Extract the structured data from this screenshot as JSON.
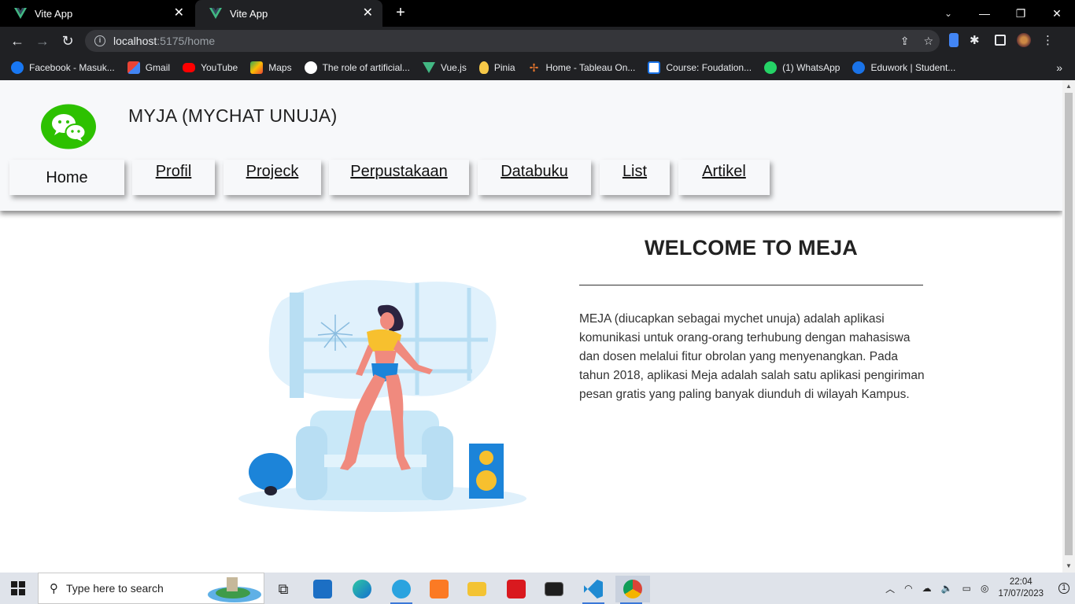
{
  "browser": {
    "tabs": [
      {
        "title": "Vite App",
        "close": "✕"
      },
      {
        "title": "Vite App",
        "close": "✕"
      }
    ],
    "new_tab": "+",
    "window_controls": {
      "minimize": "—",
      "restore": "❐",
      "close": "✕"
    },
    "address": {
      "host": "localhost",
      "path": ":5175/home"
    },
    "bookmarks": [
      {
        "label": "Facebook - Masuk...",
        "color": "#1877f2"
      },
      {
        "label": "Gmail",
        "color": "#ea4335"
      },
      {
        "label": "YouTube",
        "color": "#ff0000"
      },
      {
        "label": "Maps",
        "color": "#34a853"
      },
      {
        "label": "The role of artificial...",
        "color": "#ffffff"
      },
      {
        "label": "Vue.js",
        "color": "#42b883"
      },
      {
        "label": "Pinia",
        "color": "#f7c948"
      },
      {
        "label": "Home - Tableau On...",
        "color": "#e8762d"
      },
      {
        "label": "Course: Foudation...",
        "color": "#ffffff"
      },
      {
        "label": "(1) WhatsApp",
        "color": "#25d366"
      },
      {
        "label": "Eduwork | Student...",
        "color": "#1a73e8"
      }
    ],
    "bookmarks_more": "»"
  },
  "app": {
    "brand_title": "MYJA (MYCHAT UNUJA)",
    "logo_icon": "wechat-icon",
    "accent": "#2dc100",
    "nav": [
      {
        "label": "Home",
        "active": true
      },
      {
        "label": "Profil",
        "active": false
      },
      {
        "label": "Projeck",
        "active": false
      },
      {
        "label": "Perpustakaan",
        "active": false
      },
      {
        "label": "Databuku",
        "active": false
      },
      {
        "label": "List",
        "active": false
      },
      {
        "label": "Artikel",
        "active": false
      }
    ],
    "welcome_title": "WELCOME TO MEJA",
    "description": "MEJA (diucapkan sebagai mychet unuja) adalah aplikasi komunikasi untuk orang-orang terhubung dengan mahasiswa dan dosen melalui fitur obrolan yang menyenangkan. Pada tahun 2018, aplikasi Meja adalah salah satu aplikasi pengiriman pesan gratis yang paling banyak diunduh di wilayah Kampus."
  },
  "taskbar": {
    "search_placeholder": "Type here to search",
    "apps": [
      "task-view",
      "mail",
      "edge",
      "telegram",
      "xampp",
      "file-explorer",
      "acrobat",
      "terminal",
      "vscode",
      "chrome"
    ],
    "clock_time": "22:04",
    "clock_date": "17/07/2023",
    "notification_count": "1"
  }
}
